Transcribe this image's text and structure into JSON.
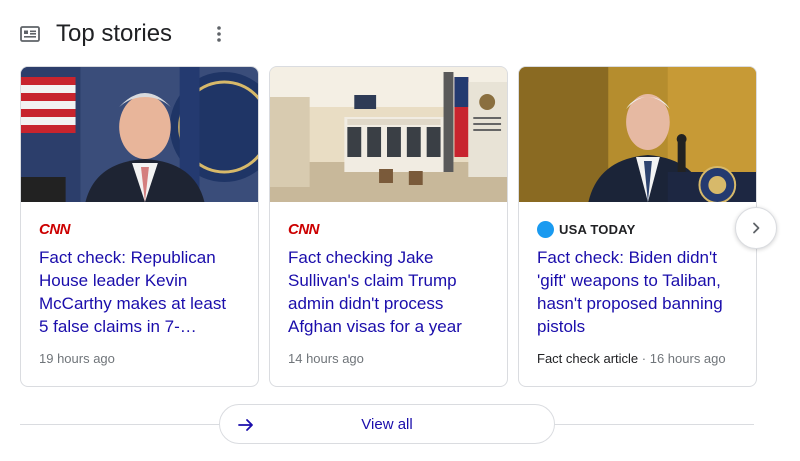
{
  "header": {
    "title": "Top stories"
  },
  "colors": {
    "link": "#1a0dab",
    "cnn_red": "#cc0000",
    "usa_today_blue": "#1a9af0",
    "meta_gray": "#70757a"
  },
  "cards": [
    {
      "source": "CNN",
      "headline": "Fact check: Republican House leader Kevin McCarthy makes at least 5 false claims in 7-…",
      "label": "",
      "time": "19 hours ago",
      "image": "photo of speaker at podium with US flags"
    },
    {
      "source": "CNN",
      "headline": "Fact checking Jake Sullivan's claim Trump admin didn't process Afghan visas for a year",
      "label": "",
      "time": "14 hours ago",
      "image": "photo of government office interior with flag"
    },
    {
      "source": "USA TODAY",
      "headline": "Fact check: Biden didn't 'gift' weapons to Taliban, hasn't proposed banning pistols",
      "label": "Fact check article",
      "time": "16 hours ago",
      "image": "photo of president speaking at podium"
    }
  ],
  "footer": {
    "view_all": "View all"
  },
  "icons": {
    "header": "news-icon",
    "menu": "more-vert-icon",
    "next": "chevron-right-icon",
    "view_all": "arrow-right-icon"
  }
}
